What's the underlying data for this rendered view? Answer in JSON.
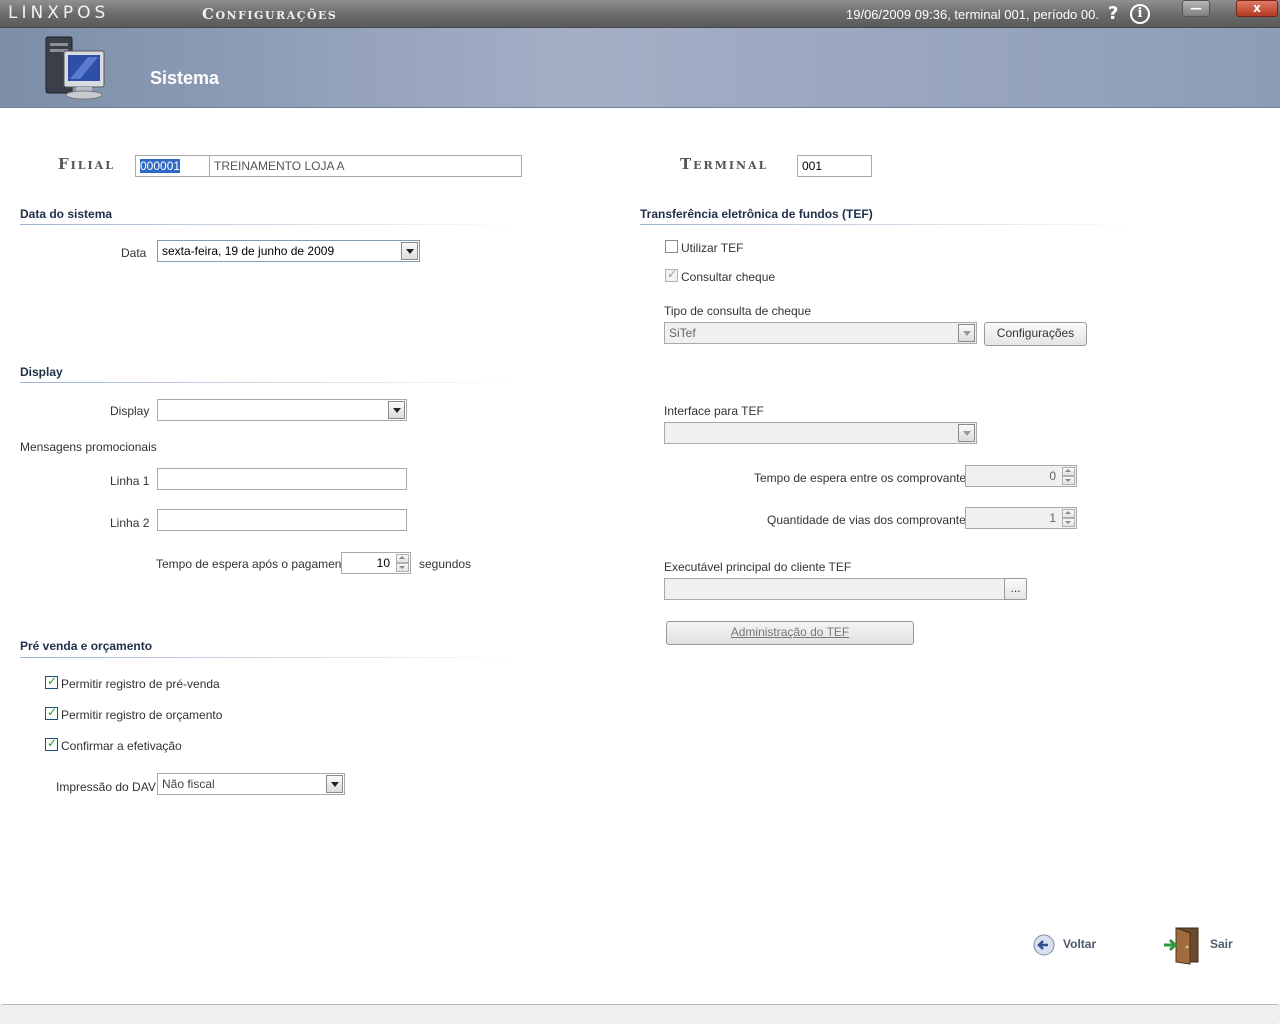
{
  "titlebar": {
    "brand": "LINXPOS",
    "app_title": "Configurações",
    "status": "19/06/2009 09:36, terminal 001, período 00.",
    "help_icon": "question-icon",
    "info_label": "i",
    "minimize_label": "—",
    "close_label": "x"
  },
  "banner": {
    "title": "Sistema",
    "icon": "computer-icon"
  },
  "header": {
    "filial_label": "Filial",
    "filial_code": "000001",
    "filial_name": "TREINAMENTO LOJA A",
    "terminal_label": "Terminal",
    "terminal_value": "001"
  },
  "data_sistema": {
    "title": "Data do sistema",
    "data_label": "Data",
    "data_value": "sexta-feira, 19 de junho de 2009"
  },
  "display": {
    "title": "Display",
    "display_label": "Display",
    "display_value": "",
    "mensagens_label": "Mensagens promocionais",
    "linha1_label": "Linha 1",
    "linha1_value": "",
    "linha2_label": "Linha 2",
    "linha2_value": "",
    "tempo_label": "Tempo de espera após o pagamento",
    "tempo_value": "10",
    "tempo_unit": "segundos"
  },
  "pre_venda": {
    "title": "Pré venda e orçamento",
    "checkboxes": [
      {
        "label": "Permitir registro de pré-venda",
        "checked": true
      },
      {
        "label": "Permitir registro de orçamento",
        "checked": true
      },
      {
        "label": "Confirmar a efetivação",
        "checked": true
      }
    ],
    "impressao_label": "Impressão do DAV",
    "impressao_value": "Não fiscal"
  },
  "tef": {
    "title": "Transferência eletrônica de fundos (TEF)",
    "utilizar_label": "Utilizar TEF",
    "utilizar_checked": false,
    "consultar_label": "Consultar cheque",
    "consultar_checked": true,
    "tipo_label": "Tipo de consulta de cheque",
    "tipo_value": "SiTef",
    "config_button": "Configurações",
    "interface_label": "Interface para TEF",
    "interface_value": "",
    "tempo_label": "Tempo de espera entre os comprovantes",
    "tempo_value": "0",
    "vias_label": "Quantidade de vias dos comprovantes",
    "vias_value": "1",
    "exec_label": "Executável principal do cliente TEF",
    "exec_value": "",
    "browse_button": "...",
    "admin_button": "Administração do TEF"
  },
  "actions": {
    "voltar": "Voltar",
    "sair": "Sair"
  },
  "colors": {
    "banner": "#9aa8c0",
    "titlebar": "#6f6f6f",
    "section_title": "#1f2f4a",
    "selection": "#316ac5"
  }
}
